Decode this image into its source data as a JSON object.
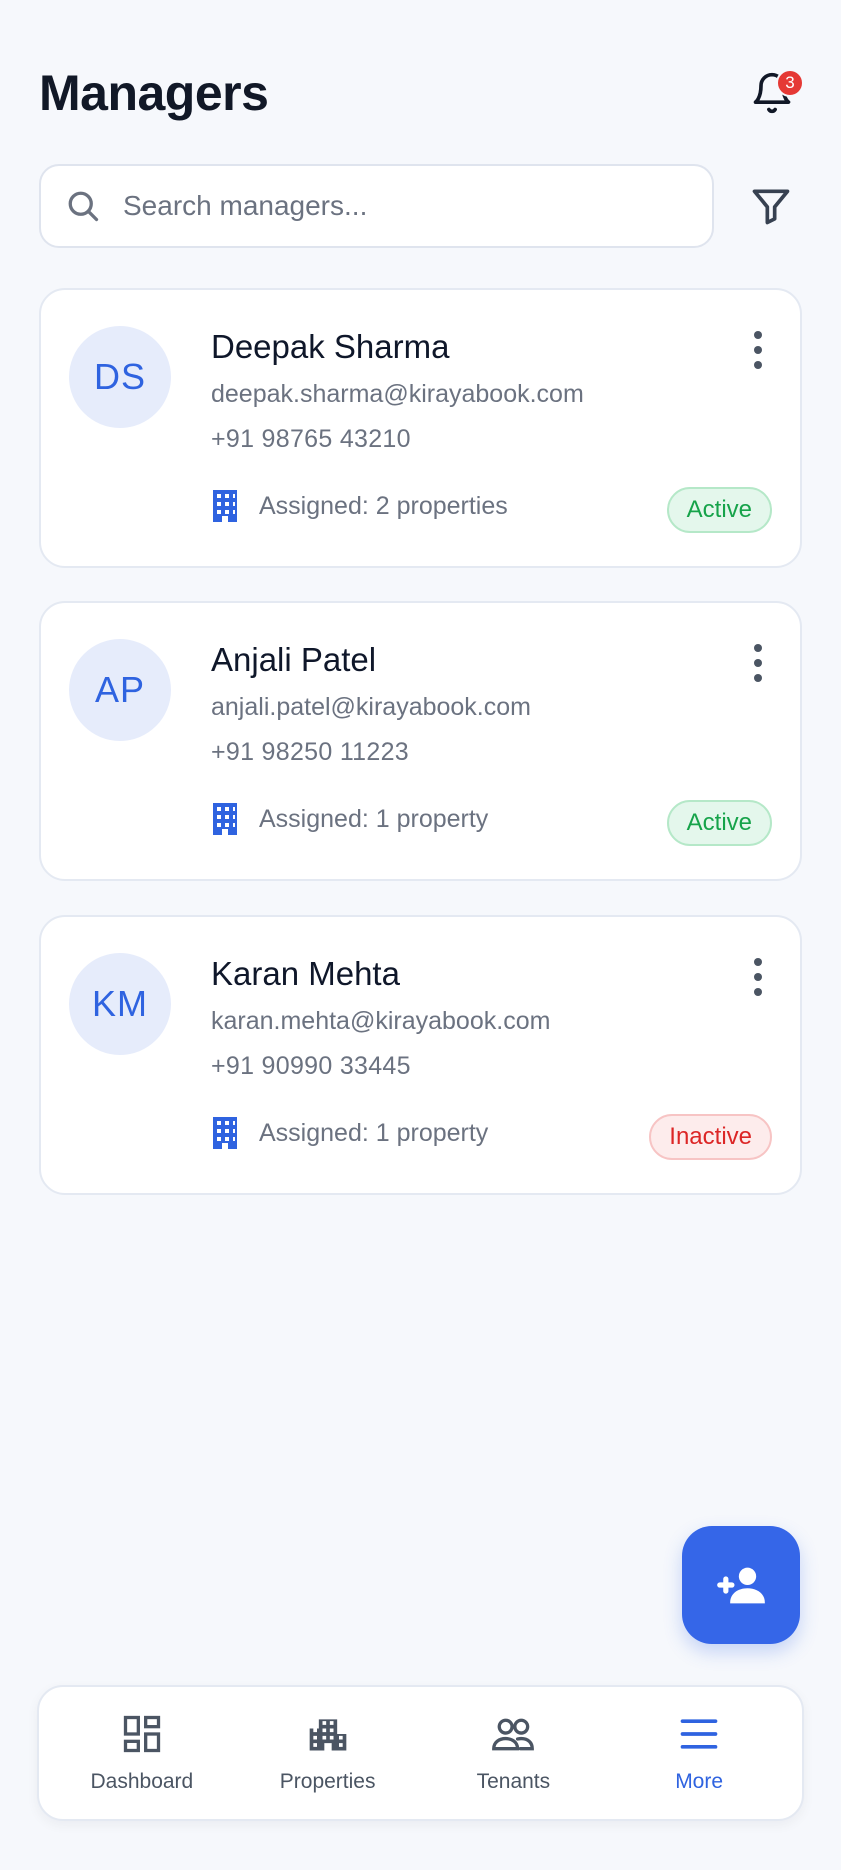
{
  "header": {
    "title": "Managers",
    "notification_count": "3"
  },
  "search": {
    "placeholder": "Search managers..."
  },
  "managers": [
    {
      "initials": "DS",
      "name": "Deepak Sharma",
      "email": "deepak.sharma@kirayabook.com",
      "phone": "+91 98765 43210",
      "assigned": "Assigned: 2 properties",
      "status": "Active",
      "status_color": "#16a34a"
    },
    {
      "initials": "AP",
      "name": "Anjali Patel",
      "email": "anjali.patel@kirayabook.com",
      "phone": "+91 98250 11223",
      "assigned": "Assigned: 1 property",
      "status": "Active",
      "status_color": "#16a34a"
    },
    {
      "initials": "KM",
      "name": "Karan Mehta",
      "email": "karan.mehta@kirayabook.com",
      "phone": "+91 90990 33445",
      "assigned": "Assigned: 1 property",
      "status": "Inactive",
      "status_color": "#dc2626"
    }
  ],
  "fab": {
    "icon": "add-user-icon"
  },
  "bottom_nav": [
    {
      "label": "Dashboard",
      "icon": "dashboard-icon",
      "active": false
    },
    {
      "label": "Properties",
      "icon": "building-icon",
      "active": false
    },
    {
      "label": "Tenants",
      "icon": "tenants-icon",
      "active": false
    },
    {
      "label": "More",
      "icon": "menu-icon",
      "active": true
    }
  ],
  "colors": {
    "accent": "#3566e8",
    "background": "#f6f8fc",
    "active_green": "#16a34a",
    "inactive_red": "#dc2626"
  }
}
